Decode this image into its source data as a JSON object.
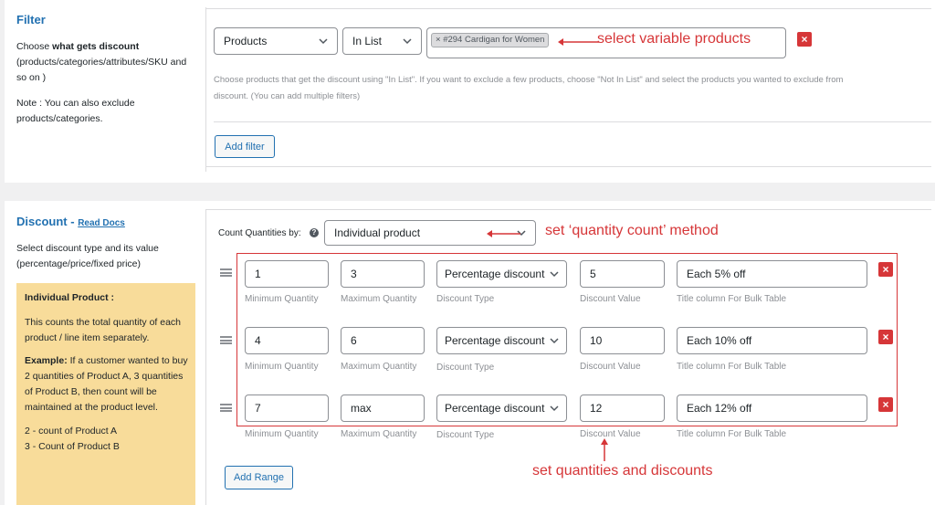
{
  "filter": {
    "title": "Filter",
    "desc_pre": "Choose ",
    "desc_bold": "what gets discount",
    "desc_post": "(products/categories/attributes/SKU and so on )",
    "note": "Note : You can also exclude products/categories.",
    "type_select": "Products",
    "method_select": "In List",
    "selected_tag": "#294 Cardigan for Women",
    "tag_remove": "×",
    "help_line1": "Choose products that get the discount using \"In List\". If you want to exclude a few products, choose \"Not In List\" and select the products you wanted to exclude from",
    "help_line2": "discount. (You can add multiple filters)",
    "add_filter": "Add filter",
    "remove": "×"
  },
  "discount": {
    "title": "Discount",
    "sep": " - ",
    "read_docs": "Read Docs",
    "desc": "Select discount type and its value (percentage/price/fixed price)",
    "info": {
      "heading": "Individual Product :",
      "p1": "This counts the total quantity of each product / line item separately.",
      "example_bold": "Example:",
      "example_text": " If a customer wanted to buy 2 quantities of Product A, 3 quantities of Product B, then count will be maintained at the product level.",
      "line1": "2 - count of Product A",
      "line2": "3 - Count of Product B"
    },
    "count_label": "Count Quantities by:",
    "count_help": "?",
    "count_select": "Individual product",
    "add_range": "Add Range",
    "labels": {
      "min": "Minimum Quantity",
      "max": "Maximum Quantity",
      "type": "Discount Type",
      "value": "Discount Value",
      "title": "Title column For Bulk Table"
    },
    "ranges": [
      {
        "min": "1",
        "max": "3",
        "type": "Percentage discount",
        "value": "5",
        "title": "Each 5% off"
      },
      {
        "min": "4",
        "max": "6",
        "type": "Percentage discount",
        "value": "10",
        "title": "Each 10% off"
      },
      {
        "min": "7",
        "max": "max",
        "type": "Percentage discount",
        "value": "12",
        "title": "Each 12% off"
      }
    ],
    "remove": "×"
  },
  "annotations": {
    "variable": "select variable products",
    "quantity_count": "set ‘quantity count’ method",
    "quantities": "set quantities and discounts"
  },
  "colors": {
    "accent": "#2271b1",
    "annotation": "#d63638",
    "info_bg": "#f8dc9a"
  }
}
